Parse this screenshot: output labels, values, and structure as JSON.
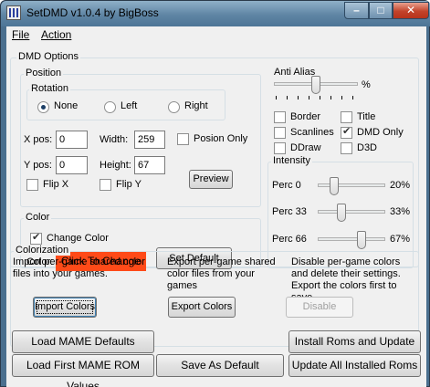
{
  "window": {
    "title": "SetDMD v1.0.4 by BigBoss",
    "minimize_glyph": "–",
    "maximize_glyph": "□",
    "close_glyph": "✕"
  },
  "menu": {
    "file": "File",
    "action": "Action"
  },
  "dmd_options": {
    "label": "DMD Options",
    "position": {
      "label": "Position",
      "rotation": {
        "label": "Rotation",
        "options": [
          "None",
          "Left",
          "Right"
        ],
        "selected": "None"
      },
      "xpos_label": "X pos:",
      "xpos_value": "0",
      "ypos_label": "Y pos:",
      "ypos_value": "0",
      "width_label": "Width:",
      "width_value": "259",
      "height_label": "Height:",
      "height_value": "67",
      "position_only_label": "Posion Only",
      "position_only_checked": false,
      "flip_x_label": "Flip X",
      "flip_x_checked": false,
      "flip_y_label": "Flip Y",
      "flip_y_checked": false,
      "preview_label": "Preview"
    },
    "color": {
      "label": "Color",
      "change_color_label": "Change Color",
      "change_color_checked": true,
      "color_label": "Color:",
      "swatch_label": "Click To Change",
      "swatch_color": "#ff4a18",
      "set_default_label": "Set Default"
    },
    "anti_alias": {
      "label": "Anti Alias",
      "value_suffix": "%",
      "level": 0.5
    },
    "display_options": [
      {
        "label": "Border",
        "checked": false
      },
      {
        "label": "Title",
        "checked": false
      },
      {
        "label": "Scanlines",
        "checked": false
      },
      {
        "label": "DMD Only",
        "checked": true
      },
      {
        "label": "DDraw",
        "checked": false
      },
      {
        "label": "D3D",
        "checked": false
      }
    ],
    "intensity": {
      "label": "Intensity",
      "rows": [
        {
          "label": "Perc 0",
          "value": "20%",
          "level": 0.2
        },
        {
          "label": "Perc 33",
          "value": "33%",
          "level": 0.33
        },
        {
          "label": "Perc 66",
          "value": "67%",
          "level": 0.67
        }
      ]
    },
    "colorization": {
      "label": "Colorization",
      "import_text": "Import per-game shared color files into your games.",
      "import_button": "Import Colors",
      "export_text": "Export per-game shared color files from your games",
      "export_button": "Export Colors",
      "disable_text": "Disable per-game colors and delete their settings. Export the colors first to save.",
      "disable_button": "Disable"
    }
  },
  "footer": {
    "load_mame_defaults": "Load MAME Defaults",
    "load_first_rom_values": "Load First MAME ROM Values",
    "save_as_default": "Save As Default",
    "install_roms_update": "Install Roms and Update",
    "update_all_installed": "Update All Installed Roms"
  }
}
